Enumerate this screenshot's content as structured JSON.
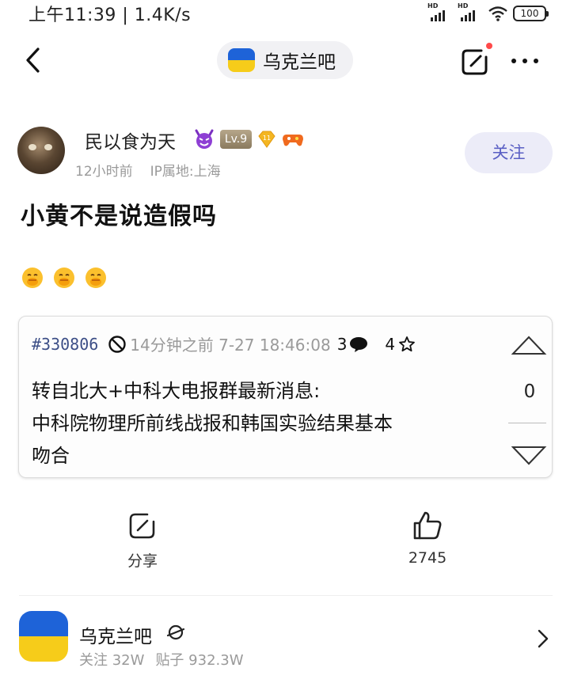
{
  "status_bar": {
    "time": "上午11:39 | 1.4K/s",
    "battery": "100",
    "icons": [
      "signal-hd-1-icon",
      "signal-hd-2-icon",
      "wifi-icon",
      "battery-icon"
    ]
  },
  "nav": {
    "forum_title": "乌克兰吧",
    "icons": [
      "back-arrow-icon",
      "ukraine-flag-icon",
      "edit-icon",
      "more-icon"
    ]
  },
  "author": {
    "name": "民以食为天",
    "level": "Lv.9",
    "gem_level": "11",
    "time": "12小时前",
    "ip_location": "IP属地:上海",
    "follow_label": "关注"
  },
  "post": {
    "title": "小黄不是说造假吗",
    "emoji_icon": "shush-face-icon"
  },
  "embedded": {
    "id": "#330806",
    "time": "14分钟之前 7-27 18:46:08",
    "comments": "3",
    "stars": "4",
    "vote": "0",
    "line1": "转自北大+中科大电报群最新消息:",
    "line2": "中科院物理所前线战报和韩国实验结果基本",
    "line3": "吻合"
  },
  "actions": {
    "share_label": "分享",
    "like_count": "2745"
  },
  "forum_card": {
    "name": "乌克兰吧",
    "followers": "关注 32W",
    "posts": "贴子 932.3W"
  },
  "colors": {
    "accent": "#5a5fc4",
    "follow_bg": "#ececf8",
    "flag_blue": "#1e63d8",
    "flag_yellow": "#f6cc1a",
    "notification_dot": "#ff4a4a"
  }
}
